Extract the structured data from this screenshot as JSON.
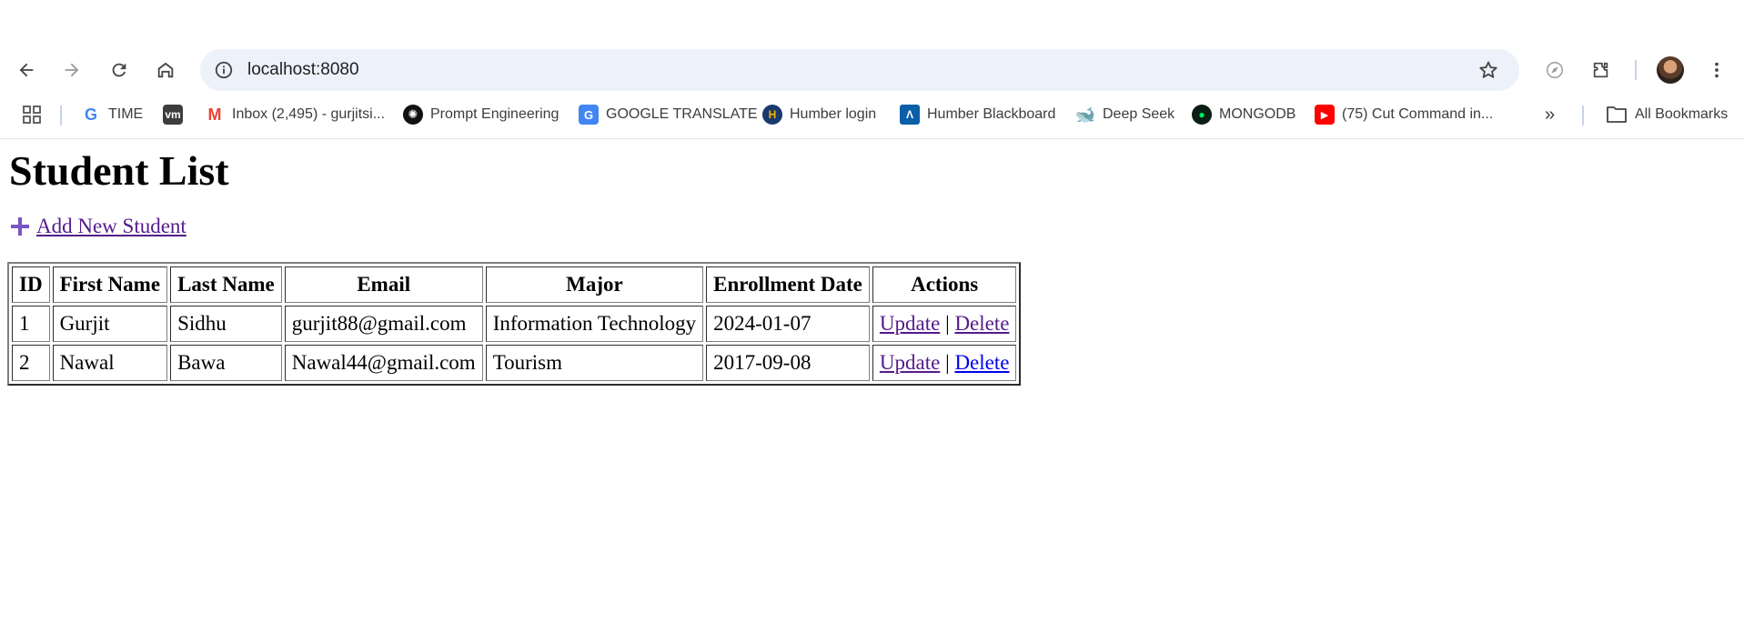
{
  "browser": {
    "url": "localhost:8080"
  },
  "bookmarks": [
    {
      "label": "TIME",
      "icon": "google-icon"
    },
    {
      "label": "",
      "icon": "vm-icon",
      "icon_text": "vm"
    },
    {
      "label": "Inbox (2,495) - gurjitsi...",
      "icon": "gmail-icon"
    },
    {
      "label": "Prompt Engineering",
      "icon": "openai-icon"
    },
    {
      "label": "GOOGLE TRANSLATE",
      "icon": "translate-icon"
    },
    {
      "label": "Humber login",
      "icon": "humber-icon"
    },
    {
      "label": "Humber Blackboard",
      "icon": "blackboard-icon"
    },
    {
      "label": "Deep Seek",
      "icon": "deepseek-icon"
    },
    {
      "label": "MONGODB",
      "icon": "mongodb-icon"
    },
    {
      "label": "(75) Cut Command in...",
      "icon": "youtube-icon"
    }
  ],
  "all_bookmarks_label": "All Bookmarks",
  "page": {
    "title": "Student List",
    "add_link": "Add New Student",
    "table": {
      "headers": [
        "ID",
        "First Name",
        "Last Name",
        "Email",
        "Major",
        "Enrollment Date",
        "Actions"
      ],
      "rows": [
        {
          "id": "1",
          "first": "Gurjit",
          "last": "Sidhu",
          "email": "gurjit88@gmail.com",
          "major": "Information Technology",
          "date": "2024-01-07",
          "update": "Update",
          "sep": "|",
          "delete": "Delete"
        },
        {
          "id": "2",
          "first": "Nawal",
          "last": "Bawa",
          "email": "Nawal44@gmail.com",
          "major": "Tourism",
          "date": "2017-09-08",
          "update": "Update",
          "sep": "|",
          "delete": "Delete"
        }
      ]
    }
  },
  "colors": {
    "visited_link": "#551a8b",
    "unvisited_link": "#0000ee",
    "omnibox_bg": "#edf1f9"
  }
}
